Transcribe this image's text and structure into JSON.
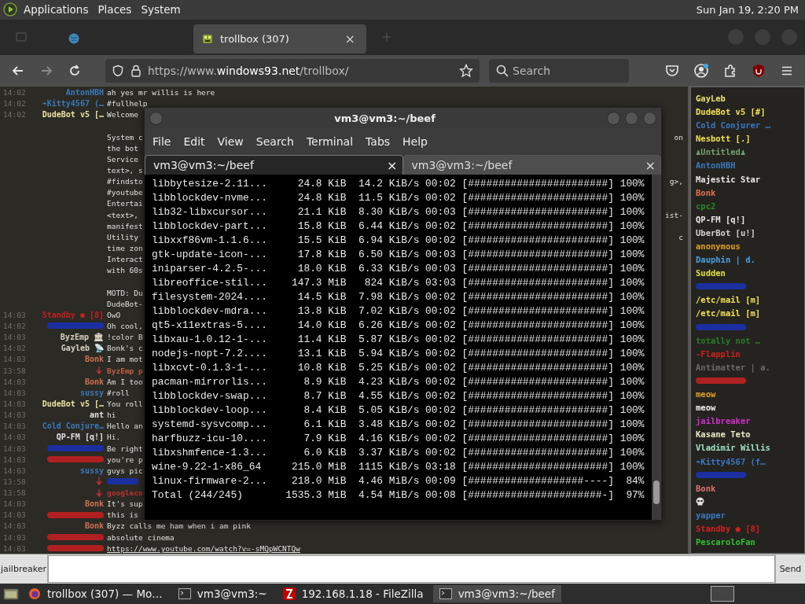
{
  "top_panel": {
    "menus": [
      "Applications",
      "Places",
      "System"
    ],
    "clock": "Sun Jan 19,  2:20 PM"
  },
  "browser_tabs": [
    {
      "label": "trollbox (307)",
      "selected": true,
      "close": "×"
    }
  ],
  "address_bar": {
    "url_prefix": "https://www.",
    "url_domain": "windows93.net",
    "url_path": "/trollbox/"
  },
  "search": {
    "placeholder": "Search"
  },
  "chat": [
    {
      "kind": "msg",
      "time": "14:02",
      "nick": "AntonHBH",
      "color": "#3a78b8",
      "text": "ah yes mr willis is here"
    },
    {
      "kind": "msg",
      "time": "14:02",
      "nick": "☂Kitty4567 (…",
      "color": "#3a78b8",
      "text": "#fullhelp"
    },
    {
      "kind": "msg",
      "time": "14:02",
      "nick": "DudeBot v5 […",
      "color": "#e8e0a0",
      "text": "Welcome"
    },
    {
      "kind": "gap"
    },
    {
      "kind": "line",
      "text": "System c",
      "tail": "on"
    },
    {
      "kind": "line",
      "text": "the bot"
    },
    {
      "kind": "line",
      "text": "Service"
    },
    {
      "kind": "line",
      "text": "text>, s"
    },
    {
      "kind": "line",
      "text": "#findsto",
      "tail": "g>,"
    },
    {
      "kind": "line",
      "text": "#youtube"
    },
    {
      "kind": "line",
      "text": "Entertai"
    },
    {
      "kind": "line",
      "text": "<text>,",
      "tail": "ist-"
    },
    {
      "kind": "line",
      "text": "manifest"
    },
    {
      "kind": "line",
      "text": "Utility",
      "tail": "c"
    },
    {
      "kind": "line",
      "text": "time zon"
    },
    {
      "kind": "line",
      "text": "Interact"
    },
    {
      "kind": "line",
      "text": "with 60s"
    },
    {
      "kind": "gap"
    },
    {
      "kind": "line",
      "text": "MOTD: Du"
    },
    {
      "kind": "line",
      "text": "DudeBot-"
    },
    {
      "kind": "msg",
      "time": "14:03",
      "nick": "Standby ● [8]",
      "color": "#c02020",
      "text": "OwO"
    },
    {
      "kind": "hidden",
      "time": "14:02",
      "color": "#1c2fa0",
      "text": "Oh cool,"
    },
    {
      "kind": "msg",
      "time": "14:03",
      "nick": "ByzEmp 🏛",
      "color": "#d8d0c0",
      "text": "!color B"
    },
    {
      "kind": "msg",
      "time": "14:02",
      "nick": "Gayleb 📡",
      "color": "#d8d0c0",
      "text": "Bonk's c"
    },
    {
      "kind": "msg",
      "time": "14:03",
      "nick": "Bonk",
      "color": "#d07050",
      "text": "I am mot"
    },
    {
      "kind": "reply",
      "time": "13:58",
      "color": "#c06040",
      "text": "ByzEmp p"
    },
    {
      "kind": "msg",
      "time": "14:03",
      "nick": "Bonk",
      "color": "#d07050",
      "text": "Am I too"
    },
    {
      "kind": "msg",
      "time": "14:03",
      "nick": "sussy",
      "color": "#3a78b8",
      "text": "#roll"
    },
    {
      "kind": "msg",
      "time": "14:03",
      "nick": "DudeBot v5 […",
      "color": "#e8e0a0",
      "text": "You roll"
    },
    {
      "kind": "msg",
      "time": "14:03",
      "nick": "ant",
      "color": "#e0e0e0",
      "text": "hi"
    },
    {
      "kind": "msg",
      "time": "14:03",
      "nick": "Cold Conjure…",
      "color": "#3a78b8",
      "text": "Hello an"
    },
    {
      "kind": "msg",
      "time": "14:03",
      "nick": "QP-FM [q!]",
      "color": "#e0e0e0",
      "text": "Hi."
    },
    {
      "kind": "hidden",
      "time": "14:03",
      "color": "#1c2fa0",
      "text": "Be right"
    },
    {
      "kind": "hidden",
      "time": "14:03",
      "color": "#b02020",
      "text": "you're p"
    },
    {
      "kind": "msg",
      "time": "14:03",
      "nick": "sussy",
      "color": "#3a78b8",
      "text": "guys pic"
    },
    {
      "kind": "reply_hidden",
      "time": "13:58",
      "color": "#1c2fa0"
    },
    {
      "kind": "reply",
      "time": "13:58",
      "color": "#c03030",
      "text": "googleco"
    },
    {
      "kind": "msg",
      "time": "14:03",
      "nick": "Bonk",
      "color": "#d07050",
      "text": "It's sup"
    },
    {
      "kind": "hidden",
      "time": "14:03",
      "color": "#b02020",
      "text": "this is"
    },
    {
      "kind": "msg",
      "time": "14:03",
      "nick": "Bonk",
      "color": "#d07050",
      "text": "Byzz calls me ham when i am pink"
    },
    {
      "kind": "hidden",
      "time": "14:03",
      "color": "#b02020",
      "text": "absolute cinema"
    },
    {
      "kind": "hidden",
      "time": "14:03",
      "color": "#b02020",
      "text": "https://www.youtube.com/watch?v=-sMQpWCNTQw",
      "link": true
    }
  ],
  "users": [
    {
      "kind": "name",
      "name": "GayLeb",
      "color": "#e8e070"
    },
    {
      "kind": "name",
      "name": "DudeBot v5 [#]",
      "color": "#f0e050"
    },
    {
      "kind": "name",
      "name": "Cold Conjurer …",
      "color": "#3a78c0"
    },
    {
      "kind": "name",
      "name": "Nesbott [.]",
      "color": "#f0e050"
    },
    {
      "kind": "name",
      "name": "♟Untitled♟",
      "color": "#70a070"
    },
    {
      "kind": "name",
      "name": "AntonHBH",
      "color": "#3a78c0"
    },
    {
      "kind": "name",
      "name": "Majestic Star",
      "color": "#e8e8e8"
    },
    {
      "kind": "name",
      "name": "Bonk",
      "color": "#e07050"
    },
    {
      "kind": "name",
      "name": "cpc2",
      "color": "#2a8a2a"
    },
    {
      "kind": "name",
      "name": "QP-FM [q!]",
      "color": "#e8e8e8"
    },
    {
      "kind": "name",
      "name": "UberBot [u!]",
      "color": "#d0d0d0"
    },
    {
      "kind": "name",
      "name": "anonymous",
      "color": "#e0a020"
    },
    {
      "kind": "name",
      "name": "Dauphin | d.",
      "color": "#4aa0e0"
    },
    {
      "kind": "name",
      "name": "Sudden",
      "color": "#e0e040"
    },
    {
      "kind": "hidden",
      "color": "#1c2fa0"
    },
    {
      "kind": "name",
      "name": "/etc/mail [m]",
      "color": "#f0e050"
    },
    {
      "kind": "name",
      "name": "/etc/mail [m]",
      "color": "#f0e050"
    },
    {
      "kind": "hidden",
      "color": "#1c2fa0"
    },
    {
      "kind": "name",
      "name": "totally not …",
      "color": "#2a7a2a"
    },
    {
      "kind": "name",
      "name": "-Flapplin",
      "color": "#d02020"
    },
    {
      "kind": "name",
      "name": "Antimatter | a.",
      "color": "#6a6a6a"
    },
    {
      "kind": "hidden",
      "color": "#b02020"
    },
    {
      "kind": "name",
      "name": "meow",
      "color": "#e0a020"
    },
    {
      "kind": "name",
      "name": "meow",
      "color": "#f0f0f0"
    },
    {
      "kind": "name",
      "name": "jailbreaker",
      "color": "#d030d0"
    },
    {
      "kind": "name",
      "name": "Kasane Teto",
      "color": "#e8e8c8"
    },
    {
      "kind": "name",
      "name": "Vladimir Willis",
      "color": "#a0e0c0"
    },
    {
      "kind": "name",
      "name": "☂Kitty4567 (f…",
      "color": "#3a78c0"
    },
    {
      "kind": "hidden",
      "color": "#1c2fa0"
    },
    {
      "kind": "name",
      "name": "Bonk",
      "color": "#e07070"
    },
    {
      "kind": "skull",
      "color": "#e0e0e0"
    },
    {
      "kind": "name",
      "name": "yapper",
      "color": "#3a78c0"
    },
    {
      "kind": "name",
      "name": "Standby ● [8]",
      "color": "#d02020"
    },
    {
      "kind": "name",
      "name": "PescaroloFan",
      "color": "#30c030"
    }
  ],
  "terminal": {
    "title": "vm3@vm3:~/beef",
    "menus": [
      "File",
      "Edit",
      "View",
      "Search",
      "Terminal",
      "Tabs",
      "Help"
    ],
    "tabs": [
      {
        "label": "vm3@vm3:~/beef",
        "selected": true,
        "close": "×"
      },
      {
        "label": "vm3@vm3:~/beef",
        "selected": false,
        "close": "×"
      }
    ],
    "lines": [
      "libbytesize-2.11...     24.8 KiB  14.2 KiB/s 00:02 [#######################] 100%",
      "libblockdev-nvme...     24.8 KiB  11.5 KiB/s 00:02 [#######################] 100%",
      "lib32-libxcursor...     21.1 KiB  8.30 KiB/s 00:03 [#######################] 100%",
      "libblockdev-part...     15.8 KiB  6.44 KiB/s 00:02 [#######################] 100%",
      "libxxf86vm-1.1.6...     15.5 KiB  6.94 KiB/s 00:02 [#######################] 100%",
      "gtk-update-icon-...     17.8 KiB  6.50 KiB/s 00:03 [#######################] 100%",
      "iniparser-4.2.5-...     18.0 KiB  6.33 KiB/s 00:03 [#######################] 100%",
      "libreoffice-stil...    147.3 MiB   824 KiB/s 03:03 [#######################] 100%",
      "filesystem-2024....     14.5 KiB  7.98 KiB/s 00:02 [#######################] 100%",
      "libblockdev-mdra...     13.8 KiB  7.02 KiB/s 00:02 [#######################] 100%",
      "qt5-x11extras-5....     14.0 KiB  6.26 KiB/s 00:02 [#######################] 100%",
      "libxau-1.0.12-1-...     11.4 KiB  5.87 KiB/s 00:02 [#######################] 100%",
      "nodejs-nopt-7.2....     13.1 KiB  5.94 KiB/s 00:02 [#######################] 100%",
      "libxcvt-0.1.3-1-...     10.8 KiB  5.25 KiB/s 00:02 [#######################] 100%",
      "pacman-mirrorlis...      8.9 KiB  4.23 KiB/s 00:02 [#######################] 100%",
      "libblockdev-swap...      8.7 KiB  4.55 KiB/s 00:02 [#######################] 100%",
      "libblockdev-loop...      8.4 KiB  5.05 KiB/s 00:02 [#######################] 100%",
      "systemd-sysvcomp...      6.1 KiB  3.48 KiB/s 00:02 [#######################] 100%",
      "harfbuzz-icu-10....      7.9 KiB  4.16 KiB/s 00:02 [#######################] 100%",
      "libxshmfence-1.3...      6.0 KiB  3.37 KiB/s 00:02 [#######################] 100%",
      "wine-9.22-1-x86_64     215.0 MiB  1115 KiB/s 03:18 [#######################] 100%",
      "linux-firmware-2...    218.0 MiB  4.46 MiB/s 00:09 [###################----]  84%",
      "Total (244/245)       1535.3 MiB  4.54 MiB/s 00:08 [######################-]  97%"
    ]
  },
  "composer": {
    "nick": "jailbreaker",
    "send": "Send"
  },
  "taskbar": [
    {
      "kind": "firefox",
      "label": "trollbox (307) — Mo…",
      "selected": false
    },
    {
      "kind": "terminal",
      "label": "vm3@vm3:~",
      "selected": false
    },
    {
      "kind": "filezilla",
      "label": "192.168.1.18 - FileZilla",
      "selected": false
    },
    {
      "kind": "terminal",
      "label": "vm3@vm3:~/beef",
      "selected": true
    }
  ]
}
